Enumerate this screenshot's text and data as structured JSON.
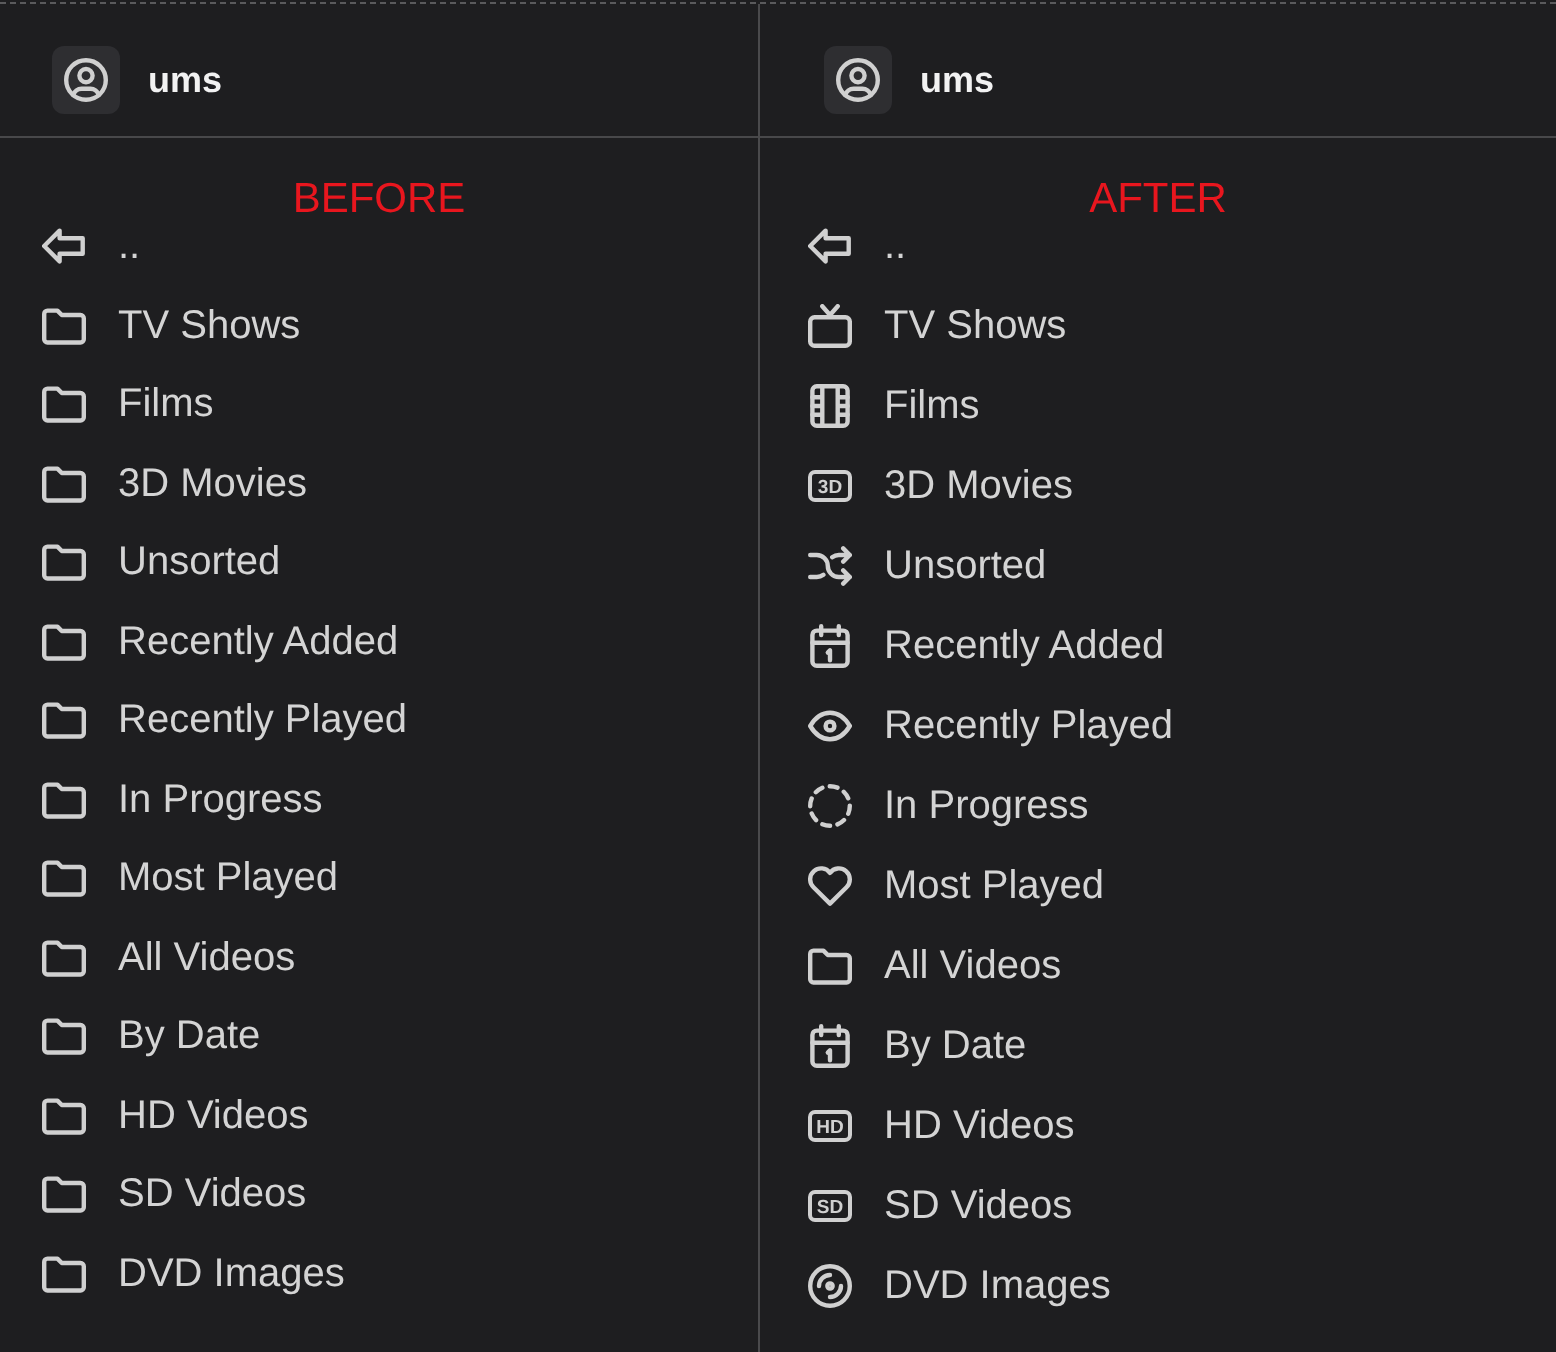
{
  "panels": [
    {
      "user": {
        "name": "ums"
      },
      "caption": "BEFORE",
      "items": [
        {
          "kind": "back",
          "label": ".."
        },
        {
          "kind": "folder",
          "label": "TV Shows"
        },
        {
          "kind": "folder",
          "label": "Films"
        },
        {
          "kind": "folder",
          "label": "3D Movies"
        },
        {
          "kind": "folder",
          "label": "Unsorted"
        },
        {
          "kind": "folder",
          "label": "Recently Added"
        },
        {
          "kind": "folder",
          "label": "Recently Played"
        },
        {
          "kind": "folder",
          "label": "In Progress"
        },
        {
          "kind": "folder",
          "label": "Most Played"
        },
        {
          "kind": "folder",
          "label": "All Videos"
        },
        {
          "kind": "folder",
          "label": "By Date"
        },
        {
          "kind": "folder",
          "label": "HD Videos"
        },
        {
          "kind": "folder",
          "label": "SD Videos"
        },
        {
          "kind": "folder",
          "label": "DVD Images"
        }
      ]
    },
    {
      "user": {
        "name": "ums"
      },
      "caption": "AFTER",
      "items": [
        {
          "kind": "back",
          "label": ".."
        },
        {
          "kind": "tv",
          "label": "TV Shows"
        },
        {
          "kind": "film",
          "label": "Films"
        },
        {
          "kind": "badge",
          "badge": "3D",
          "label": "3D Movies"
        },
        {
          "kind": "shuffle",
          "label": "Unsorted"
        },
        {
          "kind": "calendar",
          "label": "Recently Added"
        },
        {
          "kind": "eye",
          "label": "Recently Played"
        },
        {
          "kind": "progress",
          "label": "In Progress"
        },
        {
          "kind": "heart",
          "label": "Most Played"
        },
        {
          "kind": "folder",
          "label": "All Videos"
        },
        {
          "kind": "calendar",
          "label": "By Date"
        },
        {
          "kind": "badge",
          "badge": "HD",
          "label": "HD Videos"
        },
        {
          "kind": "badge",
          "badge": "SD",
          "label": "SD Videos"
        },
        {
          "kind": "disc",
          "label": "DVD Images"
        }
      ]
    }
  ]
}
